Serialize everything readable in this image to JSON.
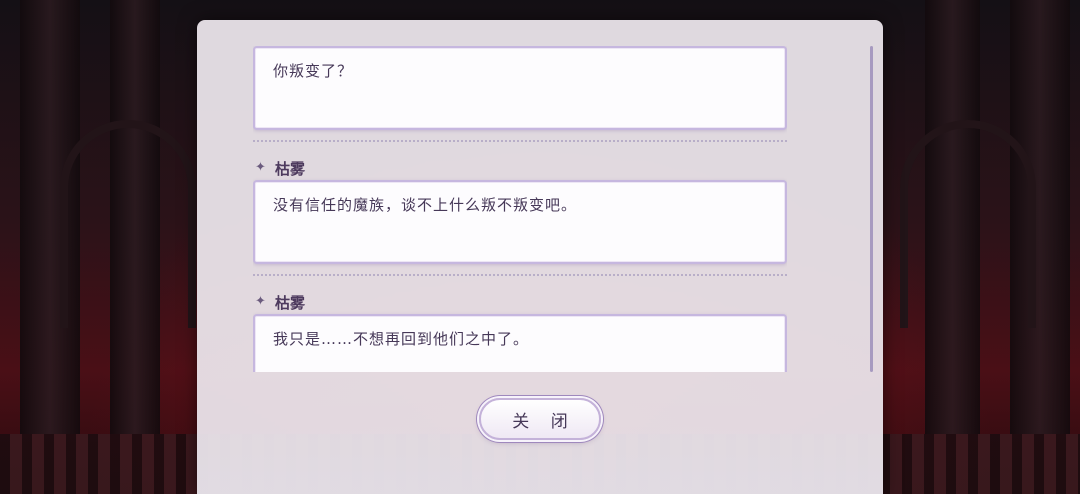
{
  "dialog_log": {
    "entries": [
      {
        "speaker": "",
        "text": "你叛变了？"
      },
      {
        "speaker": "枯雾",
        "text": "没有信任的魔族，谈不上什么叛不叛变吧。"
      },
      {
        "speaker": "枯雾",
        "text": "我只是……不想再回到他们之中了。"
      }
    ]
  },
  "buttons": {
    "close_label": "关 闭"
  },
  "icons": {
    "speaker_marker": "sparkle-star-icon"
  },
  "colors": {
    "panel": "#ece6ec",
    "bubble_border": "#c6b7df",
    "text": "#463858"
  }
}
